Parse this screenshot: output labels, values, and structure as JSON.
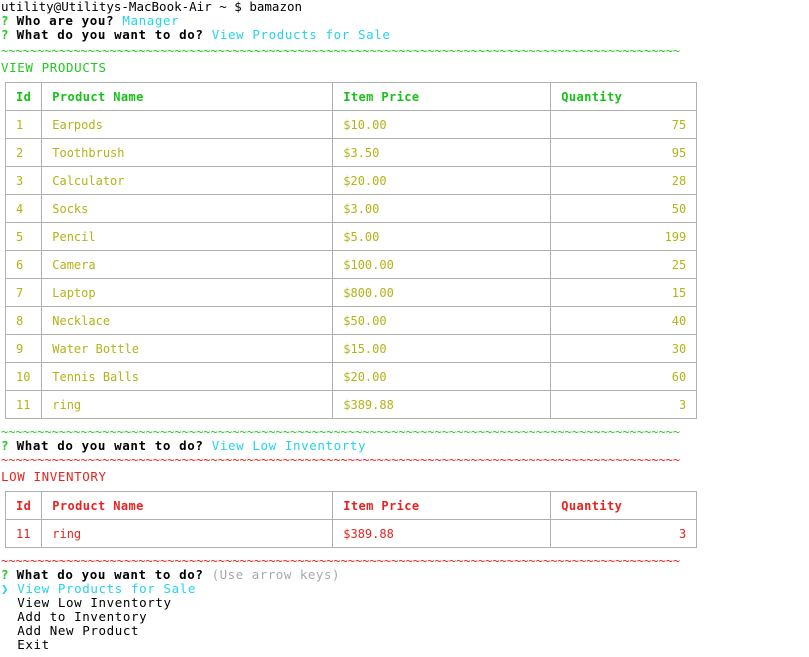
{
  "terminal": {
    "shell_prompt": "utility@Utilitys-MacBook-Air ~ $ bamazon",
    "question_marker": "?",
    "separator_green": "~~~~~~~~~~~~~~~~~~~~~~~~~~~~~~~~~~~~~~~~~~~~~~~~~~~~~~~~~~~~~~~~~~~~~~~~~~~~~~~~~~~~~~~~~~~~~~",
    "separator_red": "~~~~~~~~~~~~~~~~~~~~~~~~~~~~~~~~~~~~~~~~~~~~~~~~~~~~~~~~~~~~~~~~~~~~~~~~~~~~~~~~~~~~~~~~~~~~~~"
  },
  "prompts": {
    "who_are_you": {
      "question": "Who are you?",
      "answer": "Manager"
    },
    "action_1": {
      "question": "What do you want to do?",
      "answer": "View Products for Sale"
    },
    "action_2": {
      "question": "What do you want to do?",
      "answer": "View Low Inventorty"
    },
    "action_3": {
      "question": "What do you want to do?",
      "hint": "(Use arrow keys)"
    }
  },
  "products_section": {
    "title": "VIEW PRODUCTS",
    "columns": [
      "Id",
      "Product Name",
      "Item Price",
      "Quantity"
    ],
    "rows": [
      {
        "id": "1",
        "name": "Earpods",
        "price": "$10.00",
        "qty": "75"
      },
      {
        "id": "2",
        "name": "Toothbrush",
        "price": "$3.50",
        "qty": "95"
      },
      {
        "id": "3",
        "name": "Calculator",
        "price": "$20.00",
        "qty": "28"
      },
      {
        "id": "4",
        "name": "Socks",
        "price": "$3.00",
        "qty": "50"
      },
      {
        "id": "5",
        "name": "Pencil",
        "price": "$5.00",
        "qty": "199"
      },
      {
        "id": "6",
        "name": "Camera",
        "price": "$100.00",
        "qty": "25"
      },
      {
        "id": "7",
        "name": "Laptop",
        "price": "$800.00",
        "qty": "15"
      },
      {
        "id": "8",
        "name": "Necklace",
        "price": "$50.00",
        "qty": "40"
      },
      {
        "id": "9",
        "name": "Water Bottle",
        "price": "$15.00",
        "qty": "30"
      },
      {
        "id": "10",
        "name": "Tennis Balls",
        "price": "$20.00",
        "qty": "60"
      },
      {
        "id": "11",
        "name": "ring",
        "price": "$389.88",
        "qty": "3"
      }
    ]
  },
  "low_inventory_section": {
    "title": "LOW INVENTORY",
    "columns": [
      "Id",
      "Product Name",
      "Item Price",
      "Quantity"
    ],
    "rows": [
      {
        "id": "11",
        "name": "ring",
        "price": "$389.88",
        "qty": "3"
      }
    ]
  },
  "menu": {
    "pointer": "❯",
    "items": [
      {
        "label": "View Products for Sale",
        "selected": true
      },
      {
        "label": "View Low Inventorty",
        "selected": false
      },
      {
        "label": "Add to Inventory",
        "selected": false
      },
      {
        "label": "Add New Product",
        "selected": false
      },
      {
        "label": "Exit",
        "selected": false
      }
    ]
  },
  "colors": {
    "green": "#21c921",
    "cyan": "#22d3ee",
    "red": "#e8231f",
    "olive": "#b3b318",
    "gray": "#a8a8a8",
    "border": "#b0b0b0",
    "background": "#ffffff",
    "text": "#000000"
  }
}
